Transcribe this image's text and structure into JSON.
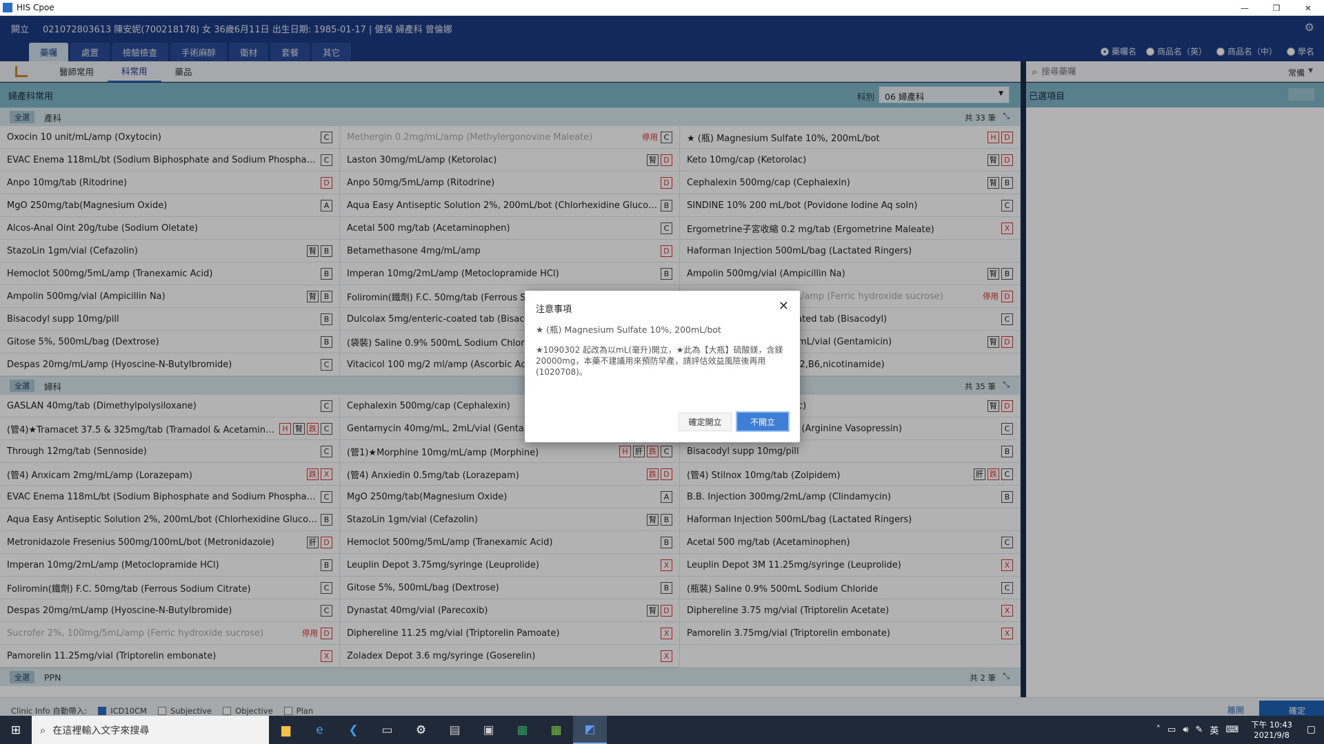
{
  "window": {
    "title": "HIS Cpoe",
    "controls": [
      "—",
      "❐",
      "✕"
    ]
  },
  "patient": {
    "org": "闕立",
    "info": "021072803613 陳安妮(700218178) 女 36歲6月11日 出生日期: 1985-01-17 | 健保 婦產科 曾倫娜"
  },
  "tabs": [
    "藥囑",
    "處置",
    "檢驗檢查",
    "手術麻醉",
    "衛材",
    "套餐",
    "其它"
  ],
  "name_options": [
    {
      "label": "藥囑名",
      "selected": true
    },
    {
      "label": "商品名（英）",
      "selected": false
    },
    {
      "label": "商品名（中）",
      "selected": false
    },
    {
      "label": "學名",
      "selected": false
    }
  ],
  "subtabs": [
    "醫師常用",
    "科常用",
    "藥品"
  ],
  "search": {
    "placeholder": "搜尋藥囑",
    "filter": "常備"
  },
  "panel": {
    "title": "婦產科常用",
    "category_label": "科別",
    "category_value": "06 婦產科"
  },
  "selected_panel": {
    "title": "已選項目"
  },
  "groups": [
    {
      "all": "全選",
      "name": "產科",
      "count": "共 33 筆",
      "items": [
        {
          "name": "Oxocin 10 unit/mL/amp (Oxytocin)",
          "tags": [
            "C"
          ]
        },
        {
          "name": "Methergin 0.2mg/mL/amp (Methylergonovine Maleate)",
          "tags": [
            "停用",
            "C"
          ],
          "dim": true
        },
        {
          "name": "★ (瓶) Magnesium Sulfate 10%, 200mL/bot",
          "tags": [
            "H",
            "D"
          ]
        },
        {
          "name": "EVAC Enema 118mL/bt (Sodium Biphosphate and Sodium Phosphate)",
          "tags": [
            "C"
          ]
        },
        {
          "name": "Laston 30mg/mL/amp (Ketorolac)",
          "tags": [
            "腎",
            "D"
          ]
        },
        {
          "name": "Keto 10mg/cap (Ketorolac)",
          "tags": [
            "腎",
            "D"
          ]
        },
        {
          "name": "Anpo 10mg/tab (Ritodrine)",
          "tags": [
            "D"
          ]
        },
        {
          "name": "Anpo 50mg/5mL/amp (Ritodrine)",
          "tags": [
            "D"
          ]
        },
        {
          "name": "Cephalexin 500mg/cap (Cephalexin)",
          "tags": [
            "腎",
            "B"
          ]
        },
        {
          "name": "MgO 250mg/tab(Magnesium Oxide)",
          "tags": [
            "A"
          ]
        },
        {
          "name": "Aqua Easy Antiseptic Solution 2%, 200mL/bot (Chlorhexidine Glucona...",
          "tags": [
            "B"
          ]
        },
        {
          "name": "SINDINE 10% 200 mL/bot (Povidone Iodine Aq soln)",
          "tags": [
            "C"
          ]
        },
        {
          "name": "Alcos-Anal Oint 20g/tube (Sodium Oletate)",
          "tags": []
        },
        {
          "name": "Acetal 500 mg/tab (Acetaminophen)",
          "tags": [
            "C"
          ]
        },
        {
          "name": "Ergometrine子宮收縮 0.2 mg/tab (Ergometrine Maleate)",
          "tags": [
            "X"
          ]
        },
        {
          "name": "StazoLin 1gm/vial (Cefazolin)",
          "tags": [
            "腎",
            "B"
          ]
        },
        {
          "name": "Betamethasone 4mg/mL/amp",
          "tags": [
            "D"
          ]
        },
        {
          "name": "Haforman Injection 500mL/bag (Lactated Ringers)",
          "tags": []
        },
        {
          "name": "Hemoclot 500mg/5mL/amp (Tranexamic Acid)",
          "tags": [
            "B"
          ]
        },
        {
          "name": "Imperan 10mg/2mL/amp (Metoclopramide HCl)",
          "tags": [
            "B"
          ]
        },
        {
          "name": "Ampolin 500mg/vial (Ampicillin Na)",
          "tags": [
            "腎",
            "B"
          ]
        },
        {
          "name": "Ampolin 500mg/vial (Ampicillin Na)",
          "tags": [
            "腎",
            "B"
          ]
        },
        {
          "name": "Foliromin(鐵劑) F.C. 50mg/tab (Ferrous Sodium Citrate)",
          "tags": []
        },
        {
          "name": "Sucrofer 2%, 100mg/5mL/amp (Ferric hydroxide sucrose)",
          "tags": [
            "停用",
            "D"
          ],
          "dim": true
        },
        {
          "name": "Bisacodyl supp 10mg/pill",
          "tags": [
            "B"
          ]
        },
        {
          "name": "Dulcolax 5mg/enteric-coated tab (Bisacodyl)",
          "tags": []
        },
        {
          "name": "Dulcolax 5mg/enteric-coated tab (Bisacodyl)",
          "tags": [
            "C"
          ]
        },
        {
          "name": "Gitose 5%, 500mL/bag (Dextrose)",
          "tags": [
            "B"
          ]
        },
        {
          "name": "(袋裝) Saline 0.9% 500mL Sodium Chloride",
          "tags": []
        },
        {
          "name": "Gentamycin 40mg/mL, 2mL/vial (Gentamicin)",
          "tags": [
            "腎",
            "D"
          ]
        },
        {
          "name": "Despas 20mg/mL/amp (Hyoscine-N-Butylbromide)",
          "tags": [
            "C"
          ]
        },
        {
          "name": "Vitacicol 100 mg/2 ml/amp (Ascorbic Acid)",
          "tags": []
        },
        {
          "name": "Vitamin B Complex (B1,B2,B6,nicotinamide)",
          "tags": []
        }
      ]
    },
    {
      "all": "全選",
      "name": "婦科",
      "count": "共 35 筆",
      "items": [
        {
          "name": "GASLAN 40mg/tab (Dimethylpolysiloxane)",
          "tags": [
            "C"
          ]
        },
        {
          "name": "Cephalexin 500mg/cap (Cephalexin)",
          "tags": []
        },
        {
          "name": "Keto 10mg/cap (Ketorolac)",
          "tags": [
            "腎",
            "D"
          ]
        },
        {
          "name": "(管4)★Tramacet 37.5 & 325mg/tab (Tramadol & Acetaminop...",
          "tags": [
            "H",
            "腎",
            "跌",
            "C"
          ]
        },
        {
          "name": "Gentamycin 40mg/mL, 2mL/vial (Gentamicin)",
          "tags": []
        },
        {
          "name": "Pitressin 20 unit/mL/amp (Arginine Vasopressin)",
          "tags": [
            "C"
          ]
        },
        {
          "name": "Through 12mg/tab (Sennoside)",
          "tags": [
            "C"
          ]
        },
        {
          "name": "(管1)★Morphine 10mg/mL/amp (Morphine)",
          "tags": [
            "H",
            "肝",
            "跌",
            "C"
          ]
        },
        {
          "name": "Bisacodyl supp 10mg/pill",
          "tags": [
            "B"
          ]
        },
        {
          "name": "(管4) Anxicam 2mg/mL/amp (Lorazepam)",
          "tags": [
            "跌",
            "X"
          ]
        },
        {
          "name": "(管4) Anxiedin 0.5mg/tab (Lorazepam)",
          "tags": [
            "跌",
            "D"
          ]
        },
        {
          "name": "(管4) Stilnox 10mg/tab (Zolpidem)",
          "tags": [
            "肝",
            "跌",
            "C"
          ]
        },
        {
          "name": "EVAC Enema 118mL/bt (Sodium Biphosphate and Sodium Phosphate)",
          "tags": [
            "C"
          ]
        },
        {
          "name": "MgO 250mg/tab(Magnesium Oxide)",
          "tags": [
            "A"
          ]
        },
        {
          "name": "B.B. Injection 300mg/2mL/amp (Clindamycin)",
          "tags": [
            "B"
          ]
        },
        {
          "name": "Aqua Easy Antiseptic Solution 2%, 200mL/bot (Chlorhexidine Glucona...",
          "tags": [
            "B"
          ]
        },
        {
          "name": "StazoLin 1gm/vial (Cefazolin)",
          "tags": [
            "腎",
            "B"
          ]
        },
        {
          "name": "Haforman Injection 500mL/bag (Lactated Ringers)",
          "tags": []
        },
        {
          "name": "Metronidazole Fresenius 500mg/100mL/bot (Metronidazole)",
          "tags": [
            "肝",
            "D"
          ]
        },
        {
          "name": "Hemoclot 500mg/5mL/amp (Tranexamic Acid)",
          "tags": [
            "B"
          ]
        },
        {
          "name": "Acetal 500 mg/tab (Acetaminophen)",
          "tags": [
            "C"
          ]
        },
        {
          "name": "Imperan 10mg/2mL/amp (Metoclopramide HCl)",
          "tags": [
            "B"
          ]
        },
        {
          "name": "Leuplin Depot 3.75mg/syringe (Leuprolide)",
          "tags": [
            "X"
          ]
        },
        {
          "name": "Leuplin Depot 3M 11.25mg/syringe (Leuprolide)",
          "tags": [
            "X"
          ]
        },
        {
          "name": "Foliromin(鐵劑) F.C. 50mg/tab (Ferrous Sodium Citrate)",
          "tags": [
            "C"
          ]
        },
        {
          "name": "Gitose 5%, 500mL/bag (Dextrose)",
          "tags": [
            "B"
          ]
        },
        {
          "name": "(瓶裝) Saline 0.9% 500mL Sodium Chloride",
          "tags": [
            "C"
          ]
        },
        {
          "name": "Despas 20mg/mL/amp (Hyoscine-N-Butylbromide)",
          "tags": [
            "C"
          ]
        },
        {
          "name": "Dynastat 40mg/vial (Parecoxib)",
          "tags": [
            "腎",
            "D"
          ]
        },
        {
          "name": "Diphereline 3.75 mg/vial (Triptorelin Acetate)",
          "tags": [
            "X"
          ]
        },
        {
          "name": "Sucrofer 2%, 100mg/5mL/amp (Ferric hydroxide sucrose)",
          "tags": [
            "停用",
            "D"
          ],
          "dim": true
        },
        {
          "name": "Diphereline 11.25 mg/vial (Triptorelin Pamoate)",
          "tags": [
            "X"
          ]
        },
        {
          "name": "Pamorelin 3.75mg/vial (Triptorelin embonate)",
          "tags": [
            "X"
          ]
        },
        {
          "name": "Pamorelin 11.25mg/vial (Triptorelin embonate)",
          "tags": [
            "X"
          ]
        },
        {
          "name": "Zoladex Depot 3.6 mg/syringe (Goserelin)",
          "tags": [
            "X"
          ]
        }
      ]
    },
    {
      "all": "全選",
      "name": "PPN",
      "count": "共 2 筆",
      "items": []
    }
  ],
  "footer": {
    "clinic_info_label": "Clinic Info 自動帶入:",
    "checks": [
      {
        "label": "ICD10CM",
        "checked": true
      },
      {
        "label": "Subjective",
        "checked": false
      },
      {
        "label": "Objective",
        "checked": false
      },
      {
        "label": "Plan",
        "checked": false
      }
    ],
    "cancel": "離開",
    "ok": "確定"
  },
  "dialog": {
    "title": "注意事項",
    "drug": "★ (瓶) Magnesium Sulfate 10%, 200mL/bot",
    "message": "★1090302 起改為以mL(毫升)開立，★此為【大瓶】硫酸鎂，含鎂20000mg，本藥不建議用來預防早產，請評估效益風險後再用(1020708)。",
    "confirm_label": "確定開立",
    "cancel_label": "不開立"
  },
  "taskbar": {
    "search_placeholder": "在這裡輸入文字來搜尋",
    "apps": [
      "folder-icon",
      "ie-icon",
      "vscode-icon",
      "terminal-icon",
      "settings-icon",
      "printer-icon",
      "console-icon",
      "excel-icon",
      "excel2-icon",
      "his-icon"
    ],
    "ime": "英",
    "time": "下午 10:43",
    "date": "2021/9/8"
  }
}
